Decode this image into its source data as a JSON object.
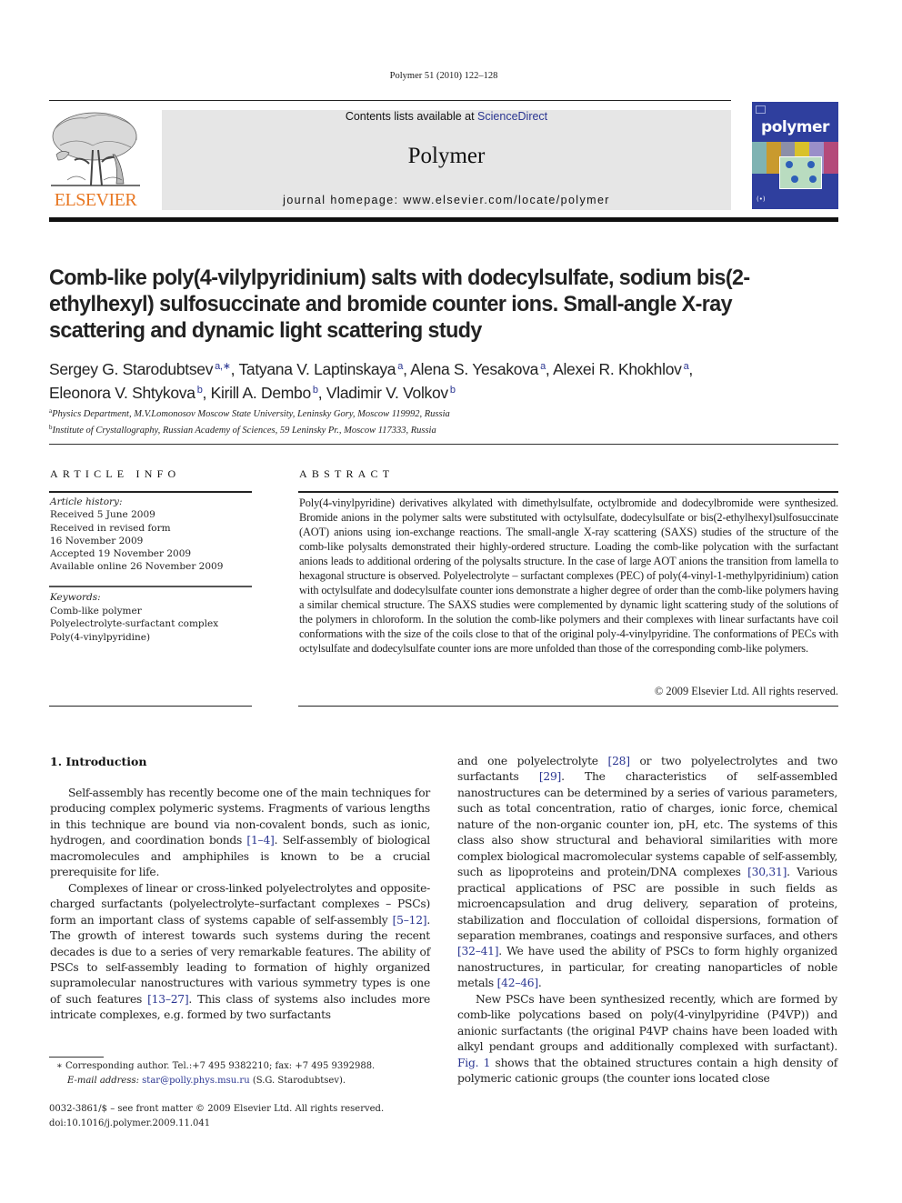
{
  "header": {
    "citation": "Polymer 51 (2010) 122–128",
    "contents_prefix": "Contents lists available at ",
    "contents_link": "ScienceDirect",
    "journal_name": "Polymer",
    "homepage": "journal homepage: www.elsevier.com/locate/polymer",
    "publisher_logo_text": "ELSEVIER",
    "cover_title": "polymer",
    "cover_mark": "(•)"
  },
  "colors": {
    "link": "#2a3591",
    "elsevier_orange": "#e87722",
    "masthead_bg": "#e6e6e6",
    "cover_blue": "#2f3f9e"
  },
  "article": {
    "title": "Comb-like poly(4-vilylpyridinium) salts with dodecylsulfate, sodium bis(2-ethylhexyl) sulfosuccinate and bromide counter ions. Small-angle X-ray scattering and dynamic light scattering study",
    "authors": [
      {
        "name": "Sergey G. Starodubtsev",
        "aff": "a,∗",
        "sep": ", "
      },
      {
        "name": "Tatyana V. Laptinskaya",
        "aff": "a",
        "sep": ", "
      },
      {
        "name": "Alena S. Yesakova",
        "aff": "a",
        "sep": ", "
      },
      {
        "name": "Alexei R. Khokhlov",
        "aff": "a",
        "sep": ","
      },
      {
        "name": "Eleonora V. Shtykova",
        "aff": "b",
        "sep": ", "
      },
      {
        "name": "Kirill A. Dembo",
        "aff": "b",
        "sep": ", "
      },
      {
        "name": "Vladimir V. Volkov",
        "aff": "b",
        "sep": ""
      }
    ],
    "affiliations": [
      {
        "key": "a",
        "text": "Physics Department, M.V.Lomonosov Moscow State University, Leninsky Gory, Moscow 119992, Russia"
      },
      {
        "key": "b",
        "text": "Institute of Crystallography, Russian Academy of Sciences, 59 Leninsky Pr., Moscow 117333, Russia"
      }
    ]
  },
  "article_info": {
    "heading": "ARTICLE INFO",
    "history_label": "Article history:",
    "history": [
      "Received 5 June 2009",
      "Received in revised form",
      "16 November 2009",
      "Accepted 19 November 2009",
      "Available online 26 November 2009"
    ],
    "keywords_label": "Keywords:",
    "keywords": [
      "Comb-like polymer",
      "Polyelectrolyte-surfactant complex",
      "Poly(4-vinylpyridine)"
    ]
  },
  "abstract": {
    "heading": "ABSTRACT",
    "text": "Poly(4-vinylpyridine) derivatives alkylated with dimethylsulfate, octylbromide and dodecylbromide were synthesized. Bromide anions in the polymer salts were substituted with octylsulfate, dodecylsulfate or bis(2-ethylhexyl)sulfosuccinate (AOT) anions using ion-exchange reactions. The small-angle X-ray scattering (SAXS) studies of the structure of the comb-like polysalts demonstrated their highly-ordered structure. Loading the comb-like polycation with the surfactant anions leads to additional ordering of the polysalts structure. In the case of large AOT anions the transition from lamella to hexagonal structure is observed. Polyelectrolyte – surfactant complexes (PEC) of poly(4-vinyl-1-methylpyridinium) cation with octylsulfate and dodecylsulfate counter ions demonstrate a higher degree of order than the comb-like polymers having a similar chemical structure. The SAXS studies were complemented by dynamic light scattering study of the solutions of the polymers in chloroform. In the solution the comb-like polymers and their complexes with linear surfactants have coil conformations with the size of the coils close to that of the original poly-4-vinylpyridine. The conformations of PECs with octylsulfate and dodecylsulfate counter ions are more unfolded than those of the corresponding comb-like polymers.",
    "copyright": "© 2009 Elsevier Ltd. All rights reserved."
  },
  "introduction": {
    "heading": "1.  Introduction",
    "left_paragraphs": [
      [
        {
          "t": "Self-assembly has recently become one of the main techniques for producing complex polymeric systems. Fragments of various lengths in this technique are bound via non-covalent bonds, such as ionic, hydrogen, and coordination bonds "
        },
        {
          "t": "[1–4]",
          "link": true
        },
        {
          "t": ". Self-assembly of biological macromolecules and amphiphiles is known to be a crucial prerequisite for life."
        }
      ],
      [
        {
          "t": "Complexes of linear or cross-linked polyelectrolytes and opposite-charged surfactants (polyelectrolyte–surfactant complexes – PSCs) form an important class of systems capable of self-assembly "
        },
        {
          "t": "[5–12]",
          "link": true
        },
        {
          "t": ". The growth of interest towards such systems during the recent decades is due to a series of very remarkable features. The ability of PSCs to self-assembly leading to formation of highly organized supramolecular nanostructures with various symmetry types is one of such features "
        },
        {
          "t": "[13–27]",
          "link": true
        },
        {
          "t": ". This class of systems also includes more intricate complexes, e.g. formed by two surfactants"
        }
      ]
    ],
    "right_paragraphs": [
      [
        {
          "t": "and one polyelectrolyte "
        },
        {
          "t": "[28]",
          "link": true
        },
        {
          "t": " or two polyelectrolytes and two surfactants "
        },
        {
          "t": "[29]",
          "link": true
        },
        {
          "t": ". The characteristics of self-assembled nanostructures can be determined by a series of various parameters, such as total concentration, ratio of charges, ionic force, chemical nature of the non-organic counter ion, pH, etc. The systems of this class also show structural and behavioral similarities with more complex biological macromolecular systems capable of self-assembly, such as lipoproteins and protein/DNA complexes "
        },
        {
          "t": "[30,31]",
          "link": true
        },
        {
          "t": ". Various practical applications of PSC are possible in such fields as microencapsulation and drug delivery, separation of proteins, stabilization and flocculation of colloidal dispersions, formation of separation membranes, coatings and responsive surfaces, and others "
        },
        {
          "t": "[32–41]",
          "link": true
        },
        {
          "t": ". We have used the ability of PSCs to form highly organized nanostructures, in particular, for creating nanoparticles of noble metals "
        },
        {
          "t": "[42–46]",
          "link": true
        },
        {
          "t": "."
        }
      ],
      [
        {
          "t": "New PSCs have been synthesized recently, which are formed by comb-like polycations based on poly(4-vinylpyridine (P4VP)) and anionic surfactants (the original P4VP chains have been loaded with alkyl pendant groups and additionally complexed with surfactant). "
        },
        {
          "t": "Fig. 1",
          "link": true
        },
        {
          "t": " shows that the obtained structures contain a high density of polymeric cationic groups (the counter ions located close"
        }
      ]
    ]
  },
  "footnotes": {
    "corresponding": "∗  Corresponding author. Tel.:+7 495 9382210; fax: +7 495 9392988.",
    "email_label": "E-mail address: ",
    "email": "star@polly.phys.msu.ru",
    "email_suffix": " (S.G. Starodubtsev).",
    "front_matter": "0032-3861/$ – see front matter © 2009 Elsevier Ltd. All rights reserved.",
    "doi": "doi:10.1016/j.polymer.2009.11.041"
  }
}
